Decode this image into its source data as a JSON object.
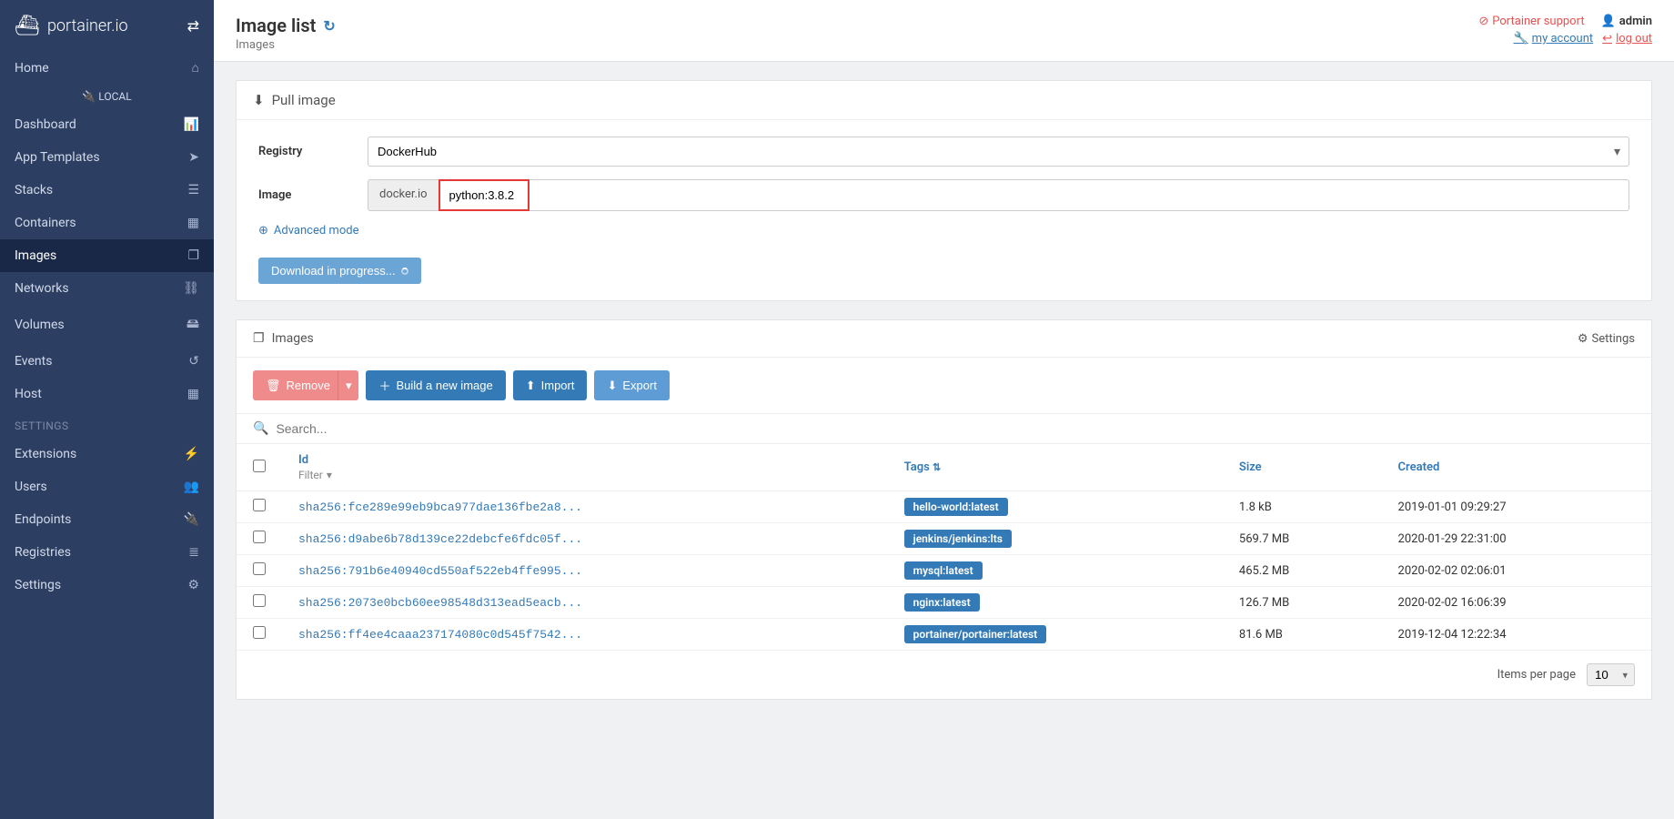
{
  "brand": {
    "name": "portainer.io"
  },
  "header": {
    "title": "Image list",
    "subtitle": "Images",
    "support": "Portainer support",
    "user": "admin",
    "my_account": "my account",
    "logout": "log out"
  },
  "sidebar": {
    "home": "Home",
    "local": "LOCAL",
    "items": [
      {
        "label": "Dashboard"
      },
      {
        "label": "App Templates"
      },
      {
        "label": "Stacks"
      },
      {
        "label": "Containers"
      },
      {
        "label": "Images"
      },
      {
        "label": "Networks"
      },
      {
        "label": "Volumes"
      },
      {
        "label": "Events"
      },
      {
        "label": "Host"
      }
    ],
    "settings_title": "SETTINGS",
    "settings_items": [
      {
        "label": "Extensions"
      },
      {
        "label": "Users"
      },
      {
        "label": "Endpoints"
      },
      {
        "label": "Registries"
      },
      {
        "label": "Settings"
      }
    ]
  },
  "pull": {
    "title": "Pull image",
    "registry_label": "Registry",
    "registry_value": "DockerHub",
    "image_label": "Image",
    "image_prefix": "docker.io",
    "image_value": "python:3.8.2",
    "advanced": "Advanced mode",
    "progress": "Download in progress..."
  },
  "images": {
    "title": "Images",
    "settings": "Settings",
    "remove": "Remove",
    "build": "Build a new image",
    "import": "Import",
    "export": "Export",
    "search_placeholder": "Search...",
    "cols": {
      "id": "Id",
      "filter": "Filter",
      "tags": "Tags",
      "size": "Size",
      "created": "Created"
    },
    "rows": [
      {
        "id": "sha256:fce289e99eb9bca977dae136fbe2a8...",
        "tag": "hello-world:latest",
        "size": "1.8 kB",
        "created": "2019-01-01 09:29:27"
      },
      {
        "id": "sha256:d9abe6b78d139ce22debcfe6fdc05f...",
        "tag": "jenkins/jenkins:lts",
        "size": "569.7 MB",
        "created": "2020-01-29 22:31:00"
      },
      {
        "id": "sha256:791b6e40940cd550af522eb4ffe995...",
        "tag": "mysql:latest",
        "size": "465.2 MB",
        "created": "2020-02-02 02:06:01"
      },
      {
        "id": "sha256:2073e0bcb60ee98548d313ead5eacb...",
        "tag": "nginx:latest",
        "size": "126.7 MB",
        "created": "2020-02-02 16:06:39"
      },
      {
        "id": "sha256:ff4ee4caaa237174080c0d545f7542...",
        "tag": "portainer/portainer:latest",
        "size": "81.6 MB",
        "created": "2019-12-04 12:22:34"
      }
    ],
    "items_per_page": "Items per page",
    "page_size": "10"
  }
}
